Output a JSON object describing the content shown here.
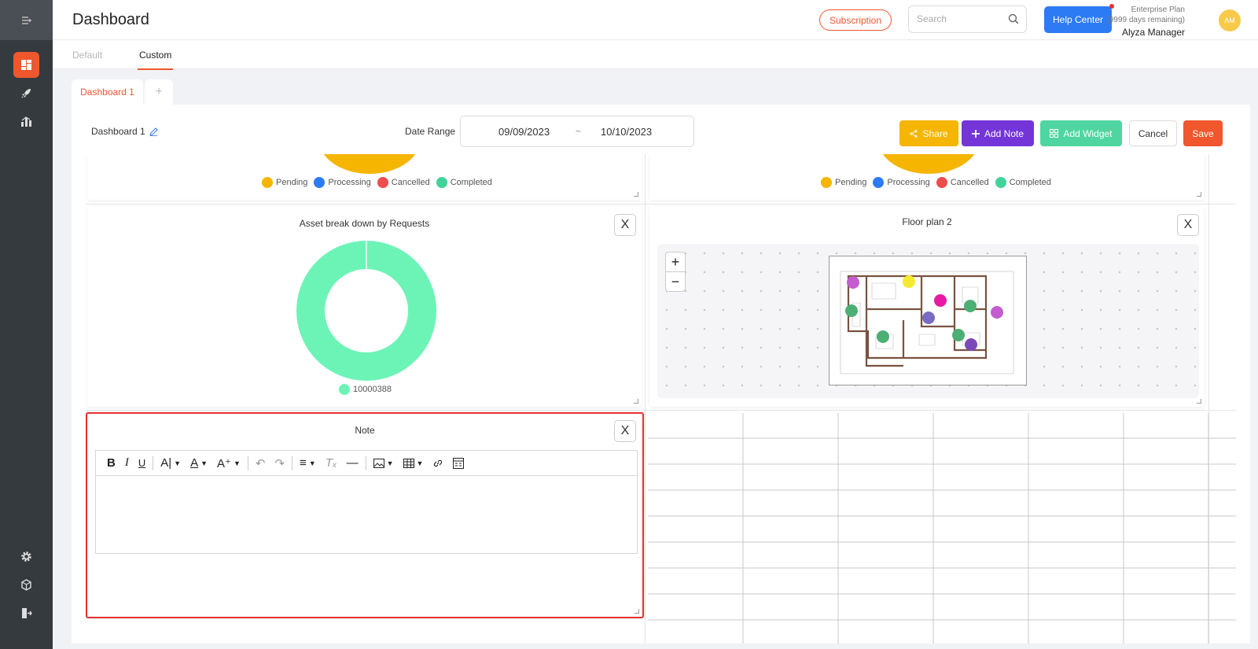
{
  "header": {
    "title": "Dashboard",
    "subscription_label": "Subscription",
    "search_placeholder": "Search",
    "help_label": "Help Center",
    "plan_name": "Enterprise Plan",
    "plan_remaining": "(9999 days remaining)",
    "user_name": "Alyza Manager",
    "avatar_initials": "AM"
  },
  "tabs": [
    {
      "label": "Default",
      "active": false
    },
    {
      "label": "Custom",
      "active": true
    }
  ],
  "dashboard_tabs": {
    "active": "Dashboard 1",
    "add": "+"
  },
  "toolbar": {
    "dashboard_name": "Dashboard 1",
    "date_range_label": "Date Range",
    "date_from": "09/09/2023",
    "date_sep": "~",
    "date_to": "10/10/2023",
    "share": "Share",
    "add_note": "Add Note",
    "add_widget": "Add Widget",
    "cancel": "Cancel",
    "save": "Save"
  },
  "status_legend": [
    {
      "label": "Pending",
      "color": "#f5b500"
    },
    {
      "label": "Processing",
      "color": "#2d7bf4"
    },
    {
      "label": "Cancelled",
      "color": "#ee4d4d"
    },
    {
      "label": "Completed",
      "color": "#42d39a"
    }
  ],
  "asset_widget": {
    "title": "Asset break down by Requests",
    "legend_label": "10000388",
    "color": "#6cf4b6"
  },
  "floor_widget": {
    "title": "Floor plan 2",
    "zoom_in": "+",
    "zoom_out": "−",
    "markers": [
      {
        "color": "#c45ccf"
      },
      {
        "color": "#f4ea32"
      },
      {
        "color": "#e81aa4"
      },
      {
        "color": "#4caf74"
      },
      {
        "color": "#c45ccf"
      },
      {
        "color": "#7b6ac1"
      },
      {
        "color": "#4caf74"
      },
      {
        "color": "#4caf74"
      },
      {
        "color": "#4caf74"
      },
      {
        "color": "#7b4ab8"
      }
    ]
  },
  "note_widget": {
    "title": "Note"
  },
  "close_label": "X",
  "colors": {
    "accent": "#f0572d",
    "sidebar": "#353a3f"
  }
}
